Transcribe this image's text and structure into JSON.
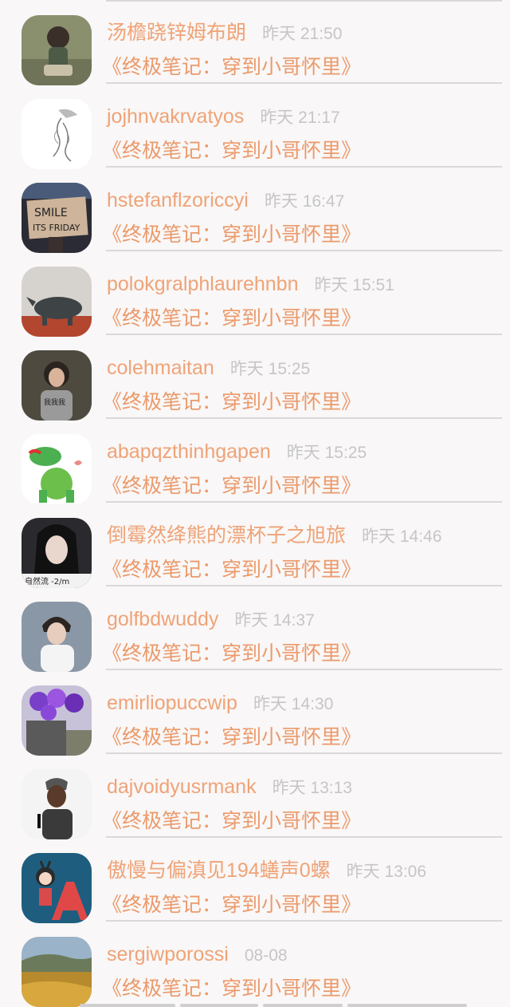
{
  "comments": [
    {
      "name": "汤檐跷锌姆布朗",
      "time": "昨天 21:50",
      "book": "《终极笔记：穿到小哥怀里》",
      "avatar_icon": "girl-sitting-photo"
    },
    {
      "name": "jojhnvakrvatyos",
      "time": "昨天 21:17",
      "book": "《终极笔记：穿到小哥怀里》",
      "avatar_icon": "sketch-figure"
    },
    {
      "name": "hstefanflzoriccyi",
      "time": "昨天 16:47",
      "book": "《终极笔记：穿到小哥怀里》",
      "avatar_icon": "smile-sign-photo"
    },
    {
      "name": "polokgralphlaurehnbn",
      "time": "昨天 15:51",
      "book": "《终极笔记：穿到小哥怀里》",
      "avatar_icon": "rhino-statue-photo"
    },
    {
      "name": "colehmaitan",
      "time": "昨天 15:25",
      "book": "《终极笔记：穿到小哥怀里》",
      "avatar_icon": "girl-portrait-photo"
    },
    {
      "name": "abapqzthinhgapen",
      "time": "昨天 15:25",
      "book": "《终极笔记：穿到小哥怀里》",
      "avatar_icon": "frog-cartoon"
    },
    {
      "name": "倒霉然绛熊的漂杯子之旭旅",
      "time": "昨天 14:46",
      "book": "《终极笔记：穿到小哥怀里》",
      "avatar_icon": "woman-selfie-photo"
    },
    {
      "name": "golfbdwuddy",
      "time": "昨天 14:37",
      "book": "《终极笔记：穿到小哥怀里》",
      "avatar_icon": "young-man-photo"
    },
    {
      "name": "emirliopuccwip",
      "time": "昨天 14:30",
      "book": "《终极笔记：穿到小哥怀里》",
      "avatar_icon": "purple-balloons-photo"
    },
    {
      "name": "dajvoidyusrmank",
      "time": "昨天 13:13",
      "book": "《终极笔记：穿到小哥怀里》",
      "avatar_icon": "singer-photo"
    },
    {
      "name": "傲慢与偏滇见194蟮声0螺",
      "time": "昨天 13:06",
      "book": "《终极笔记：穿到小哥怀里》",
      "avatar_icon": "letter-a-cartoon"
    },
    {
      "name": "sergiwporossi",
      "time": "08-08",
      "book": "《终极笔记：穿到小哥怀里》",
      "avatar_icon": "landscape-photo"
    }
  ],
  "colors": {
    "name": "#efa377",
    "book": "#eb9a6b",
    "time": "#c6c6c6",
    "background": "#f9f7f7"
  }
}
